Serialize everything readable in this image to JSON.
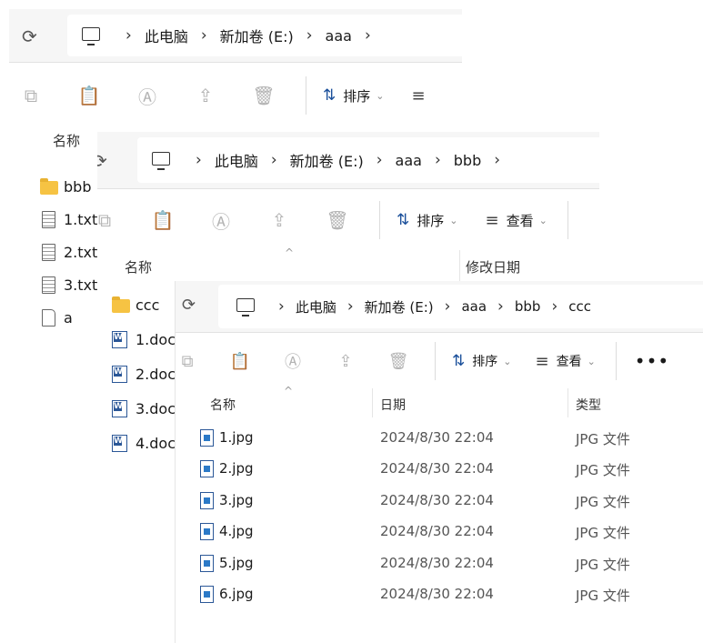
{
  "windows": [
    {
      "breadcrumb": [
        "此电脑",
        "新加卷 (E:)",
        "aaa"
      ],
      "toolbar": {
        "sort_label": "排序"
      },
      "columns": {
        "name": "名称"
      },
      "files": [
        {
          "name": "bbb",
          "icon": "folder"
        },
        {
          "name": "1.txt",
          "icon": "txt"
        },
        {
          "name": "2.txt",
          "icon": "txt"
        },
        {
          "name": "3.txt",
          "icon": "txt"
        },
        {
          "name": "a",
          "icon": "blank"
        }
      ]
    },
    {
      "breadcrumb": [
        "此电脑",
        "新加卷 (E:)",
        "aaa",
        "bbb"
      ],
      "toolbar": {
        "sort_label": "排序",
        "view_label": "查看"
      },
      "columns": {
        "name": "名称",
        "modified": "修改日期"
      },
      "files": [
        {
          "name": "ccc",
          "icon": "folder"
        },
        {
          "name": "1.doc",
          "icon": "doc"
        },
        {
          "name": "2.doc",
          "icon": "doc"
        },
        {
          "name": "3.doc",
          "icon": "doc"
        },
        {
          "name": "4.doc",
          "icon": "doc"
        }
      ]
    },
    {
      "breadcrumb": [
        "此电脑",
        "新加卷 (E:)",
        "aaa",
        "bbb",
        "ccc"
      ],
      "toolbar": {
        "sort_label": "排序",
        "view_label": "查看",
        "more_label": "•••"
      },
      "columns": {
        "name": "名称",
        "date": "日期",
        "type": "类型"
      },
      "files": [
        {
          "name": "1.jpg",
          "date": "2024/8/30 22:04",
          "type": "JPG 文件",
          "icon": "jpg"
        },
        {
          "name": "2.jpg",
          "date": "2024/8/30 22:04",
          "type": "JPG 文件",
          "icon": "jpg"
        },
        {
          "name": "3.jpg",
          "date": "2024/8/30 22:04",
          "type": "JPG 文件",
          "icon": "jpg"
        },
        {
          "name": "4.jpg",
          "date": "2024/8/30 22:04",
          "type": "JPG 文件",
          "icon": "jpg"
        },
        {
          "name": "5.jpg",
          "date": "2024/8/30 22:04",
          "type": "JPG 文件",
          "icon": "jpg"
        },
        {
          "name": "6.jpg",
          "date": "2024/8/30 22:04",
          "type": "JPG 文件",
          "icon": "jpg"
        }
      ]
    }
  ],
  "icons": {
    "refresh": "refresh-icon",
    "computer": "computer-icon",
    "copy": "copy-icon",
    "paste": "paste-icon",
    "rename": "rename-icon",
    "share": "share-icon",
    "delete": "delete-icon",
    "sort": "sort-icon",
    "view": "view-icon",
    "folder": "folder-icon",
    "txt": "text-file-icon",
    "doc": "word-doc-icon",
    "jpg": "image-file-icon"
  },
  "colors": {
    "folder": "#f6c343",
    "word": "#2b5797",
    "accent": "#1a4f9a"
  }
}
